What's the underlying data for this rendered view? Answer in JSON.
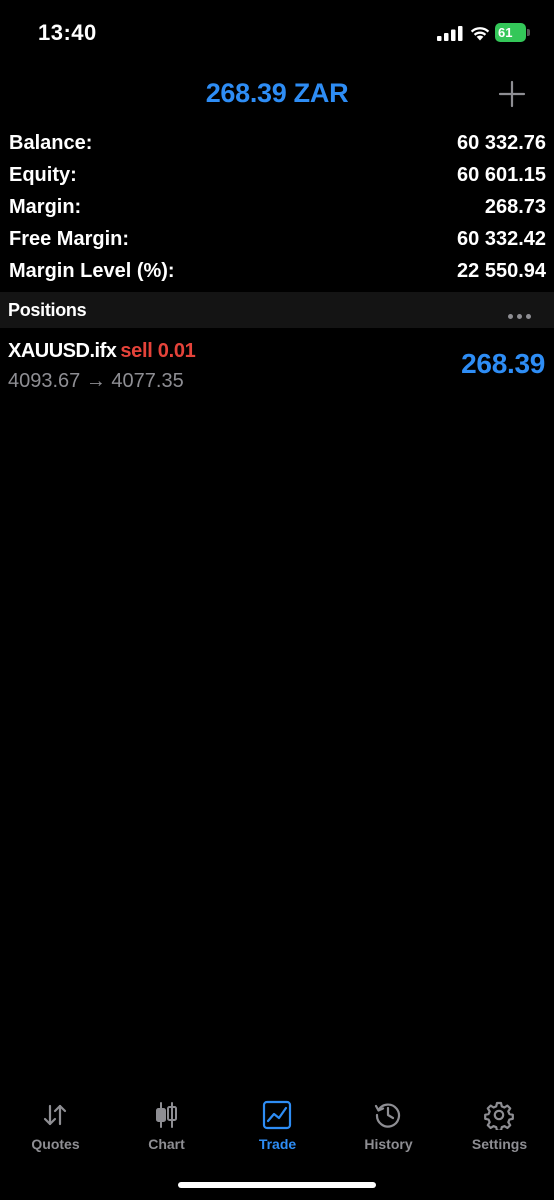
{
  "status_bar": {
    "time": "13:40",
    "battery_level": "61",
    "icons": [
      "signal-icon",
      "wifi-icon",
      "battery-icon"
    ]
  },
  "header": {
    "title": "268.39 ZAR",
    "add_icon": "plus-icon"
  },
  "account": {
    "rows": [
      {
        "label": "Balance:",
        "value": "60 332.76"
      },
      {
        "label": "Equity:",
        "value": "60 601.15"
      },
      {
        "label": "Margin:",
        "value": "268.73"
      },
      {
        "label": "Free Margin:",
        "value": "60 332.42"
      },
      {
        "label": "Margin Level (%):",
        "value": "22 550.94"
      }
    ]
  },
  "positions": {
    "title": "Positions",
    "more_icon": "ellipsis-icon",
    "items": [
      {
        "symbol": "XAUUSD.ifx",
        "side_volume": "sell 0.01",
        "prices": "4093.67 → 4077.35",
        "profit": "268.39"
      }
    ]
  },
  "tabs": [
    {
      "label": "Quotes",
      "icon": "quotes-arrows-icon",
      "active": false
    },
    {
      "label": "Chart",
      "icon": "candlestick-icon",
      "active": false
    },
    {
      "label": "Trade",
      "icon": "trade-chart-icon",
      "active": true
    },
    {
      "label": "History",
      "icon": "history-clock-icon",
      "active": false
    },
    {
      "label": "Settings",
      "icon": "gear-icon",
      "active": false
    }
  ],
  "colors": {
    "accent": "#2e8df5",
    "sell": "#e5433a",
    "battery": "#34c759",
    "muted": "#8e8e93",
    "background": "#000000"
  }
}
